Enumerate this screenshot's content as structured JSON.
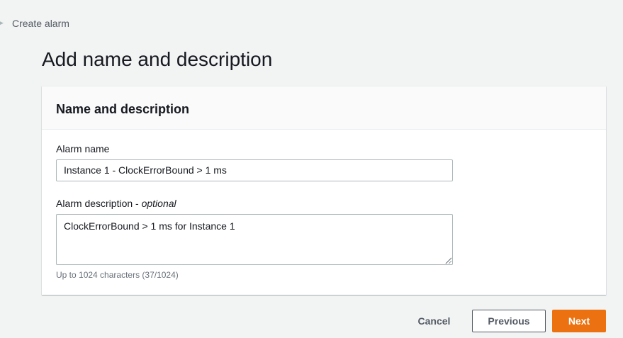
{
  "breadcrumb": {
    "current": "Create alarm"
  },
  "page_title": "Add name and description",
  "panel": {
    "title": "Name and description",
    "alarm_name_label": "Alarm name",
    "alarm_name_value": "Instance 1 - ClockErrorBound > 1 ms",
    "alarm_description_label": "Alarm description - ",
    "alarm_description_optional": "optional",
    "alarm_description_value": "ClockErrorBound > 1 ms for Instance 1",
    "hint": "Up to 1024 characters (37/1024)"
  },
  "actions": {
    "cancel": "Cancel",
    "previous": "Previous",
    "next": "Next"
  },
  "colors": {
    "primary": "#ec7211"
  }
}
